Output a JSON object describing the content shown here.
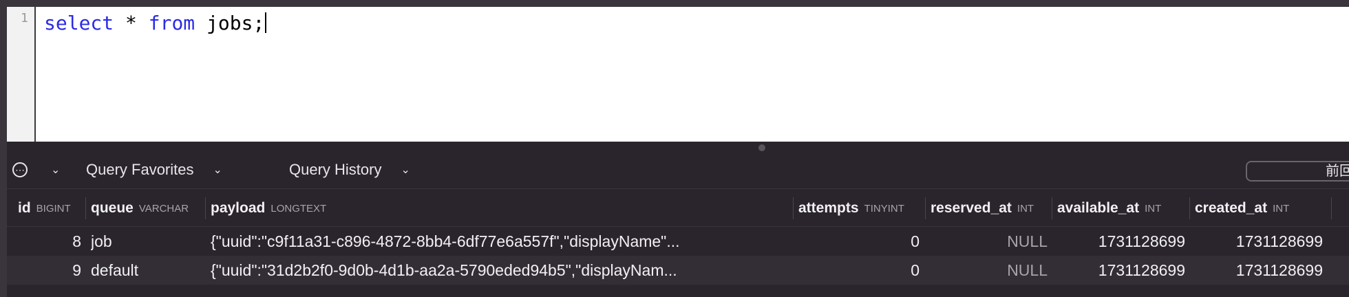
{
  "editor": {
    "line_number": "1",
    "tokens": {
      "kw_select": "select",
      "star": " * ",
      "kw_from": "from",
      "rest": " jobs;"
    }
  },
  "toolbar": {
    "more_icon": "ellipsis-circle-icon",
    "favorites_label": "Query Favorites",
    "history_label": "Query History",
    "filter_text": "前回"
  },
  "table": {
    "columns": [
      {
        "name": "id",
        "type": "BIGINT"
      },
      {
        "name": "queue",
        "type": "VARCHAR"
      },
      {
        "name": "payload",
        "type": "LONGTEXT"
      },
      {
        "name": "attempts",
        "type": "TINYINT"
      },
      {
        "name": "reserved_at",
        "type": "INT"
      },
      {
        "name": "available_at",
        "type": "INT"
      },
      {
        "name": "created_at",
        "type": "INT"
      }
    ],
    "rows": [
      {
        "id": "8",
        "queue": "job",
        "payload": "{\"uuid\":\"c9f11a31-c896-4872-8bb4-6df77e6a557f\",\"displayName\"...",
        "attempts": "0",
        "reserved_at": "NULL",
        "available_at": "1731128699",
        "created_at": "1731128699"
      },
      {
        "id": "9",
        "queue": "default",
        "payload": "{\"uuid\":\"31d2b2f0-9d0b-4d1b-aa2a-5790eded94b5\",\"displayNam...",
        "attempts": "0",
        "reserved_at": "NULL",
        "available_at": "1731128699",
        "created_at": "1731128699"
      }
    ]
  }
}
